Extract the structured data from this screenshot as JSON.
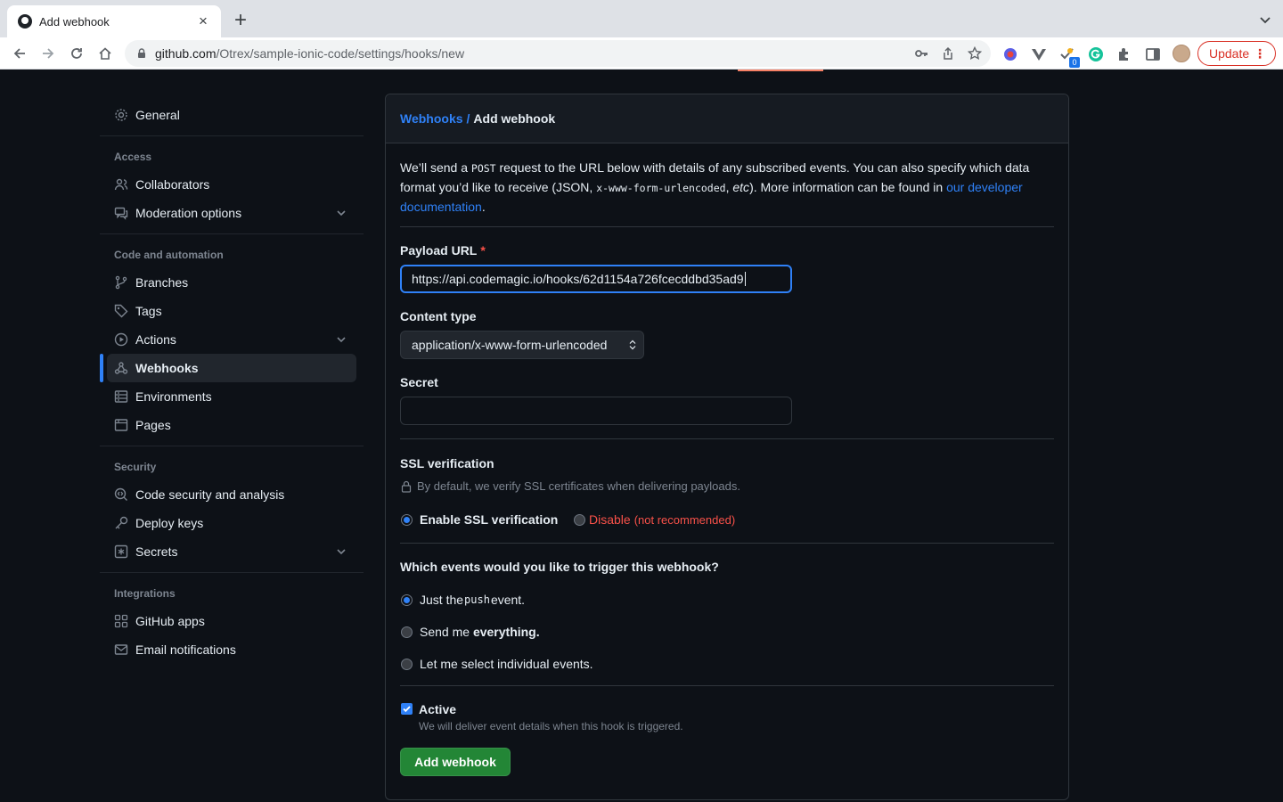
{
  "browser": {
    "tab_title": "Add webhook",
    "url_host": "github.com",
    "url_path": "/Otrex/sample-ionic-code/settings/hooks/new",
    "update_label": "Update",
    "extension_badge": "0"
  },
  "sidebar": {
    "general": "General",
    "access_heading": "Access",
    "collaborators": "Collaborators",
    "moderation": "Moderation options",
    "code_heading": "Code and automation",
    "branches": "Branches",
    "tags": "Tags",
    "actions": "Actions",
    "webhooks": "Webhooks",
    "environments": "Environments",
    "pages": "Pages",
    "security_heading": "Security",
    "code_security": "Code security and analysis",
    "deploy_keys": "Deploy keys",
    "secrets": "Secrets",
    "integrations_heading": "Integrations",
    "github_apps": "GitHub apps",
    "email_notifications": "Email notifications"
  },
  "breadcrumb": {
    "parent": "Webhooks",
    "separator": "/",
    "current": "Add webhook"
  },
  "intro": {
    "p1": "We’ll send a ",
    "code1": "POST",
    "p2": " request to the URL below with details of any subscribed events. You can also specify which data format you’d like to receive (JSON, ",
    "code2": "x-www-form-urlencoded",
    "p3": ", ",
    "em": "etc",
    "p4": "). More information can be found in ",
    "link": "our developer documentation",
    "p5": "."
  },
  "form": {
    "payload_label": "Payload URL",
    "required_mark": "*",
    "payload_value": "https://api.codemagic.io/hooks/62d1154a726fcecddbd35ad9",
    "content_type_label": "Content type",
    "content_type_value": "application/x-www-form-urlencoded",
    "secret_label": "Secret",
    "secret_value": ""
  },
  "ssl": {
    "title": "SSL verification",
    "note": "By default, we verify SSL certificates when delivering payloads.",
    "enable_label": "Enable SSL verification",
    "disable_label": "Disable",
    "disable_hint": "(not recommended)"
  },
  "events": {
    "title": "Which events would you like to trigger this webhook?",
    "opt1_pre": "Just the ",
    "opt1_code": "push",
    "opt1_post": " event.",
    "opt2_pre": "Send me ",
    "opt2_bold": "everything.",
    "opt3": "Let me select individual events."
  },
  "active": {
    "label": "Active",
    "note": "We will deliver event details when this hook is triggered."
  },
  "submit_label": "Add webhook",
  "colors": {
    "accent": "#2f81f7",
    "danger": "#f85149",
    "primary_button": "#238636",
    "background": "#0d1117"
  }
}
